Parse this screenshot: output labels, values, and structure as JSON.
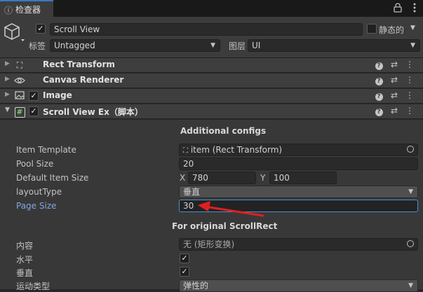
{
  "tab": {
    "title": "检查器",
    "icon": "info-icon"
  },
  "toolbar": {
    "lock_icon": "lock-icon",
    "menu_icon": "kebab-menu-icon"
  },
  "gameobject": {
    "name": "Scroll View",
    "active": true,
    "static_label": "静态的",
    "static": false,
    "tag_label": "标签",
    "tag_value": "Untagged",
    "layer_label": "图层",
    "layer_value": "UI"
  },
  "components": [
    {
      "name": "Rect Transform",
      "icon": "rect-transform-icon",
      "has_checkbox": false,
      "expanded": false
    },
    {
      "name": "Canvas Renderer",
      "icon": "eye-icon",
      "has_checkbox": false,
      "expanded": false
    },
    {
      "name": "Image",
      "icon": "image-icon",
      "has_checkbox": true,
      "checked": true,
      "expanded": false
    },
    {
      "name": "Scroll View Ex（脚本）",
      "icon": "script-hash-icon",
      "has_checkbox": true,
      "checked": true,
      "expanded": true
    }
  ],
  "script": {
    "section1_title": "Additional configs",
    "item_template_label": "Item Template",
    "item_template_value": "item (Rect Transform)",
    "pool_size_label": "Pool Size",
    "pool_size_value": "20",
    "default_item_size_label": "Default Item Size",
    "x_label": "X",
    "x_value": "780",
    "y_label": "Y",
    "y_value": "100",
    "layout_type_label": "layoutType",
    "layout_type_value": "垂直",
    "page_size_label": "Page Size",
    "page_size_value": "30",
    "section2_title": "For original ScrollRect",
    "content_label": "内容",
    "content_value": "无 (矩形变换)",
    "horizontal_label": "水平",
    "horizontal": true,
    "vertical_label": "垂直",
    "vertical": true,
    "movement_type_label": "运动类型",
    "movement_type_value": "弹性的"
  },
  "colors": {
    "accent": "#3a79bb",
    "annotation_arrow": "#e02020",
    "focused_field_border": "#4d8fd6",
    "focused_label": "#7fa9e0"
  }
}
